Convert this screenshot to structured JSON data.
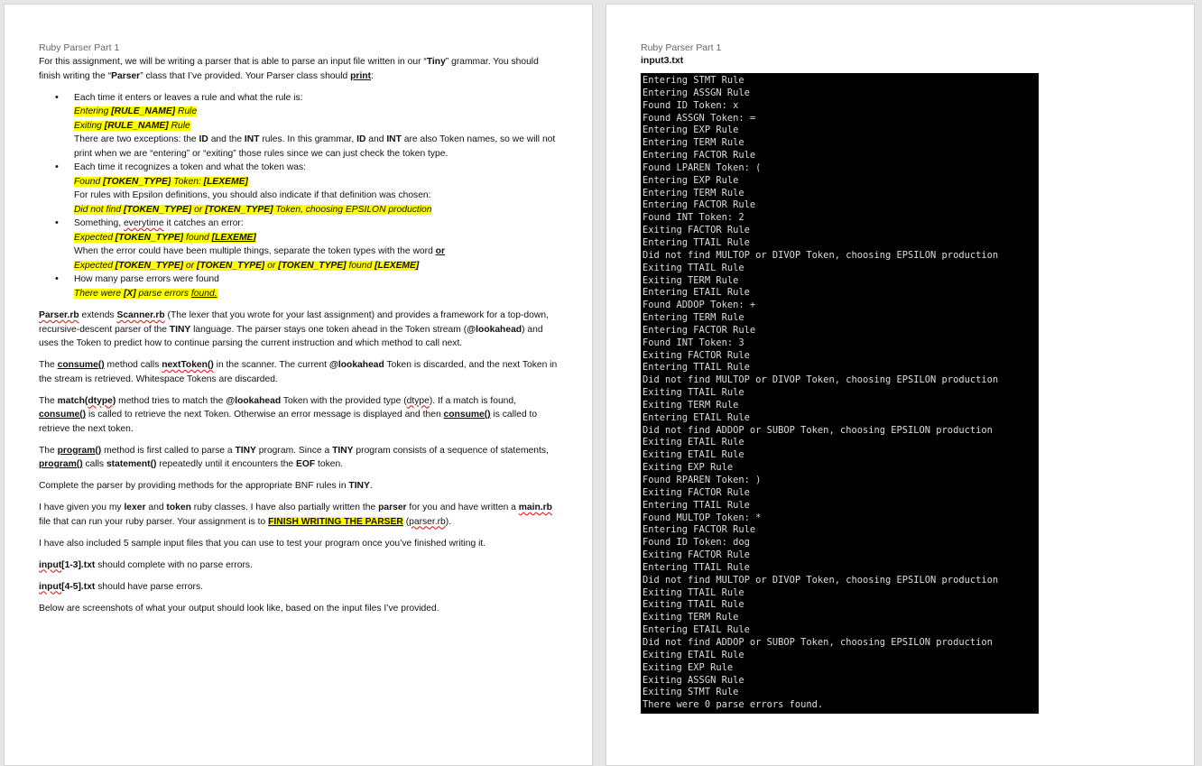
{
  "left_page": {
    "header": "Ruby Parser Part 1",
    "intro": [
      {
        "t": "For this assignment, we will be writing a parser that is able to parse an input file written in our “"
      },
      {
        "t": "Tiny",
        "s": "b"
      },
      {
        "t": "” grammar. You should finish writing the “"
      },
      {
        "t": "Parser",
        "s": "b"
      },
      {
        "t": "” class that I’ve provided. Your Parser class should "
      },
      {
        "t": "print",
        "s": "b u"
      },
      {
        "t": ":"
      }
    ],
    "bullets": [
      {
        "text": "Each time it enters or leaves a rule and what the rule is:",
        "lines": [
          [
            {
              "t": "Entering ",
              "s": "hl"
            },
            {
              "t": "[RULE_NAME]",
              "s": "hl b"
            },
            {
              "t": " Rule",
              "s": "hl"
            }
          ],
          [
            {
              "t": "Exiting ",
              "s": "hl"
            },
            {
              "t": "[RULE_NAME]",
              "s": "hl b"
            },
            {
              "t": " Rule",
              "s": "hl"
            }
          ],
          [
            {
              "t": "There are two exceptions: the "
            },
            {
              "t": "ID",
              "s": "b"
            },
            {
              "t": " and the "
            },
            {
              "t": "INT",
              "s": "b"
            },
            {
              "t": " rules. In this grammar, "
            },
            {
              "t": "ID",
              "s": "b"
            },
            {
              "t": " and "
            },
            {
              "t": "INT",
              "s": "b"
            },
            {
              "t": " are also Token names, so we will not print when we are “entering” or “exiting” those rules since we can just check the token type."
            }
          ]
        ]
      },
      {
        "text": "Each time it recognizes a token and what the token was:",
        "lines": [
          [
            {
              "t": "Found ",
              "s": "hl"
            },
            {
              "t": "[TOKEN_TYPE]",
              "s": "hl b"
            },
            {
              "t": " Token: ",
              "s": "hl"
            },
            {
              "t": "[LEXEME]",
              "s": "hl b"
            }
          ],
          [
            {
              "t": "For rules with Epsilon definitions, you should also indicate if that definition was chosen:"
            }
          ],
          [
            {
              "t": "Did not find ",
              "s": "hl"
            },
            {
              "t": "[TOKEN_TYPE]",
              "s": "hl b"
            },
            {
              "t": " or ",
              "s": "hl"
            },
            {
              "t": "[TOKEN_TYPE]",
              "s": "hl b"
            },
            {
              "t": " Token, choosing EPSILON production",
              "s": "hl"
            }
          ]
        ]
      },
      {
        "text_parts": [
          {
            "t": "Something, "
          },
          {
            "t": "everytime",
            "s": "sq"
          },
          {
            "t": " it catches an error:"
          }
        ],
        "lines": [
          [
            {
              "t": "Expected ",
              "s": "hl"
            },
            {
              "t": "[TOKEN_TYPE]",
              "s": "hl b"
            },
            {
              "t": " found ",
              "s": "hl"
            },
            {
              "t": "[LEXEME]",
              "s": "hl b u"
            },
            {
              "t": "     ",
              "s": "hl u"
            }
          ],
          [
            {
              "t": "When the error could have been multiple things, separate the token types with the word "
            },
            {
              "t": "or",
              "s": "b u"
            }
          ],
          [
            {
              "t": "Expected ",
              "s": "hl"
            },
            {
              "t": "[TOKEN_TYPE]",
              "s": "hl b"
            },
            {
              "t": " or ",
              "s": "hl"
            },
            {
              "t": "[TOKEN_TYPE]",
              "s": "hl b"
            },
            {
              "t": " or ",
              "s": "hl"
            },
            {
              "t": "[TOKEN_TYPE]",
              "s": "hl b"
            },
            {
              "t": "  found ",
              "s": "hl"
            },
            {
              "t": "[LEXEME]",
              "s": "hl b"
            }
          ]
        ]
      },
      {
        "text": "How many parse errors were found",
        "lines": [
          [
            {
              "t": "There were ",
              "s": "hl"
            },
            {
              "t": "[X]",
              "s": "hl b"
            },
            {
              "t": " parse errors ",
              "s": "hl"
            },
            {
              "t": "found.",
              "s": "hl u"
            }
          ]
        ]
      }
    ],
    "paragraphs": [
      [
        {
          "t": "Parser.rb",
          "s": "b sq"
        },
        {
          "t": " extends "
        },
        {
          "t": "Scanner.rb",
          "s": "b sq"
        },
        {
          "t": " (The lexer that you wrote for your last assignment) and provides a framework for a top-down, recursive-descent parser of the "
        },
        {
          "t": "TINY",
          "s": "b"
        },
        {
          "t": " language. The parser stays one token ahead in the Token stream ("
        },
        {
          "t": "@lookahead",
          "s": "b"
        },
        {
          "t": ") and uses the Token to predict how to continue parsing the current instruction and which method to call next."
        }
      ],
      [
        {
          "t": "The "
        },
        {
          "t": "consume()",
          "s": "b u"
        },
        {
          "t": " method calls "
        },
        {
          "t": "nextToken()",
          "s": "b sq"
        },
        {
          "t": " in the scanner. The current "
        },
        {
          "t": "@lookahead",
          "s": "b"
        },
        {
          "t": " Token is discarded, and the next Token in the stream is retrieved. Whitespace Tokens are discarded."
        }
      ],
      [
        {
          "t": "The "
        },
        {
          "t": "match(",
          "s": "b"
        },
        {
          "t": "dtype",
          "s": "b sq"
        },
        {
          "t": ")",
          "s": "b"
        },
        {
          "t": " method tries to match the "
        },
        {
          "t": "@lookahead",
          "s": "b"
        },
        {
          "t": " Token with the provided type ("
        },
        {
          "t": "dtype",
          "s": "sq"
        },
        {
          "t": "). If a match is found, "
        },
        {
          "t": "consume()",
          "s": "b u"
        },
        {
          "t": " is called to retrieve the next Token. Otherwise an error message is displayed and then "
        },
        {
          "t": "consume()",
          "s": "b u"
        },
        {
          "t": " is called to retrieve the next token."
        }
      ],
      [
        {
          "t": "The "
        },
        {
          "t": "program()",
          "s": "b u"
        },
        {
          "t": " method is first called to parse a "
        },
        {
          "t": "TINY",
          "s": "b"
        },
        {
          "t": " program. Since a "
        },
        {
          "t": "TINY",
          "s": "b"
        },
        {
          "t": " program consists of a sequence of statements, "
        },
        {
          "t": "program()",
          "s": "b u"
        },
        {
          "t": " calls "
        },
        {
          "t": "statement()",
          "s": "b"
        },
        {
          "t": " repeatedly until it encounters the "
        },
        {
          "t": "EOF",
          "s": "b"
        },
        {
          "t": " token."
        }
      ],
      [
        {
          "t": "Complete the parser by providing methods for the appropriate BNF rules in "
        },
        {
          "t": "TINY",
          "s": "b"
        },
        {
          "t": "."
        }
      ],
      [
        {
          "t": "I have given you my "
        },
        {
          "t": "lexer",
          "s": "b"
        },
        {
          "t": " and "
        },
        {
          "t": "token",
          "s": "b"
        },
        {
          "t": " ruby classes. I have also partially written the "
        },
        {
          "t": "parser",
          "s": "b"
        },
        {
          "t": " for you and have written a "
        },
        {
          "t": "main.rb",
          "s": "b sq"
        },
        {
          "t": " file that can run your ruby parser. Your assignment is to "
        },
        {
          "t": "FINISH WRITING THE PARSER",
          "s": "hlb b u"
        },
        {
          "t": " ("
        },
        {
          "t": "parser.rb",
          "s": "sq"
        },
        {
          "t": ")."
        }
      ],
      [
        {
          "t": "I have also included 5 sample input files that you can use to test your program once you’ve finished writing it."
        }
      ],
      [
        {
          "t": "input",
          "s": "b sq"
        },
        {
          "t": "[1-3].txt",
          "s": "b"
        },
        {
          "t": " should complete with no parse errors."
        }
      ],
      [
        {
          "t": "input",
          "s": "b sq"
        },
        {
          "t": "[4-5].txt",
          "s": "b"
        },
        {
          "t": " should have parse errors."
        }
      ],
      [
        {
          "t": "Below are screenshots of what your output should look like, based on the input files I’ve provided."
        }
      ]
    ]
  },
  "right_page": {
    "header": "Ruby Parser Part 1",
    "filename": "input3.txt",
    "terminal_lines": [
      "Entering STMT Rule",
      "Entering ASSGN Rule",
      "Found ID Token: x",
      "Found ASSGN Token: =",
      "Entering EXP Rule",
      "Entering TERM Rule",
      "Entering FACTOR Rule",
      "Found LPAREN Token: (",
      "Entering EXP Rule",
      "Entering TERM Rule",
      "Entering FACTOR Rule",
      "Found INT Token: 2",
      "Exiting FACTOR Rule",
      "Entering TTAIL Rule",
      "Did not find MULTOP or DIVOP Token, choosing EPSILON production",
      "Exiting TTAIL Rule",
      "Exiting TERM Rule",
      "Entering ETAIL Rule",
      "Found ADDOP Token: +",
      "Entering TERM Rule",
      "Entering FACTOR Rule",
      "Found INT Token: 3",
      "Exiting FACTOR Rule",
      "Entering TTAIL Rule",
      "Did not find MULTOP or DIVOP Token, choosing EPSILON production",
      "Exiting TTAIL Rule",
      "Exiting TERM Rule",
      "Entering ETAIL Rule",
      "Did not find ADDOP or SUBOP Token, choosing EPSILON production",
      "Exiting ETAIL Rule",
      "Exiting ETAIL Rule",
      "Exiting EXP Rule",
      "Found RPAREN Token: )",
      "Exiting FACTOR Rule",
      "Entering TTAIL Rule",
      "Found MULTOP Token: *",
      "Entering FACTOR Rule",
      "Found ID Token: dog",
      "Exiting FACTOR Rule",
      "Entering TTAIL Rule",
      "Did not find MULTOP or DIVOP Token, choosing EPSILON production",
      "Exiting TTAIL Rule",
      "Exiting TTAIL Rule",
      "Exiting TERM Rule",
      "Entering ETAIL Rule",
      "Did not find ADDOP or SUBOP Token, choosing EPSILON production",
      "Exiting ETAIL Rule",
      "Exiting EXP Rule",
      "Exiting ASSGN Rule",
      "Exiting STMT Rule",
      "There were 0 parse errors found."
    ]
  },
  "colors": {
    "highlight": "#ffff00",
    "terminal_bg": "#000000",
    "terminal_fg": "#dedede",
    "page_bg": "#ffffff",
    "workspace_bg": "#e6e6e6",
    "spellcheck": "#e02020"
  }
}
